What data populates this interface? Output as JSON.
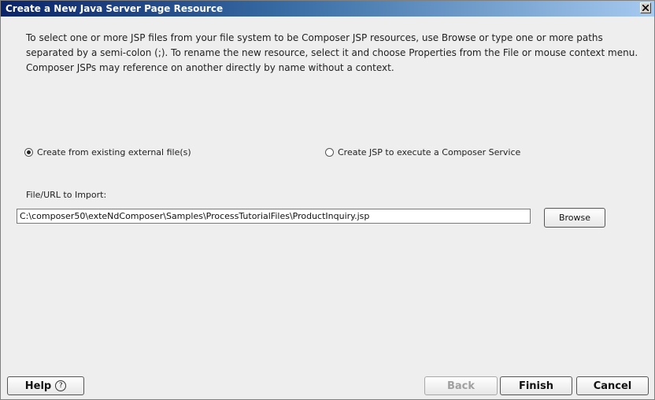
{
  "window": {
    "title": "Create a New Java Server Page Resource"
  },
  "description": "To select one or more JSP files from your file system to be Composer JSP resources, use Browse or type one or more paths separated by a semi-colon (;).  To rename the new resource, select it and choose Properties from the File or mouse context menu.  Composer JSPs may reference on another directly by name without a context.",
  "options": {
    "existing_label": "Create from existing external file(s)",
    "existing_selected": true,
    "service_label": "Create JSP to execute a Composer Service",
    "service_selected": false
  },
  "import": {
    "label": "File/URL to Import:",
    "value": "C:\\composer50\\exteNdComposer\\Samples\\ProcessTutorialFiles\\ProductInquiry.jsp",
    "browse_label": "Browse"
  },
  "footer": {
    "help_label": "Help",
    "help_icon": "?",
    "back_label": "Back",
    "back_enabled": false,
    "finish_label": "Finish",
    "cancel_label": "Cancel"
  },
  "icons": {
    "close": "close-icon",
    "help": "help-icon"
  },
  "colors": {
    "titlebar_start": "#0a246a",
    "titlebar_end": "#a6caf0",
    "dialog_bg": "#eeeeee",
    "disabled_text": "#a0a0a0"
  }
}
